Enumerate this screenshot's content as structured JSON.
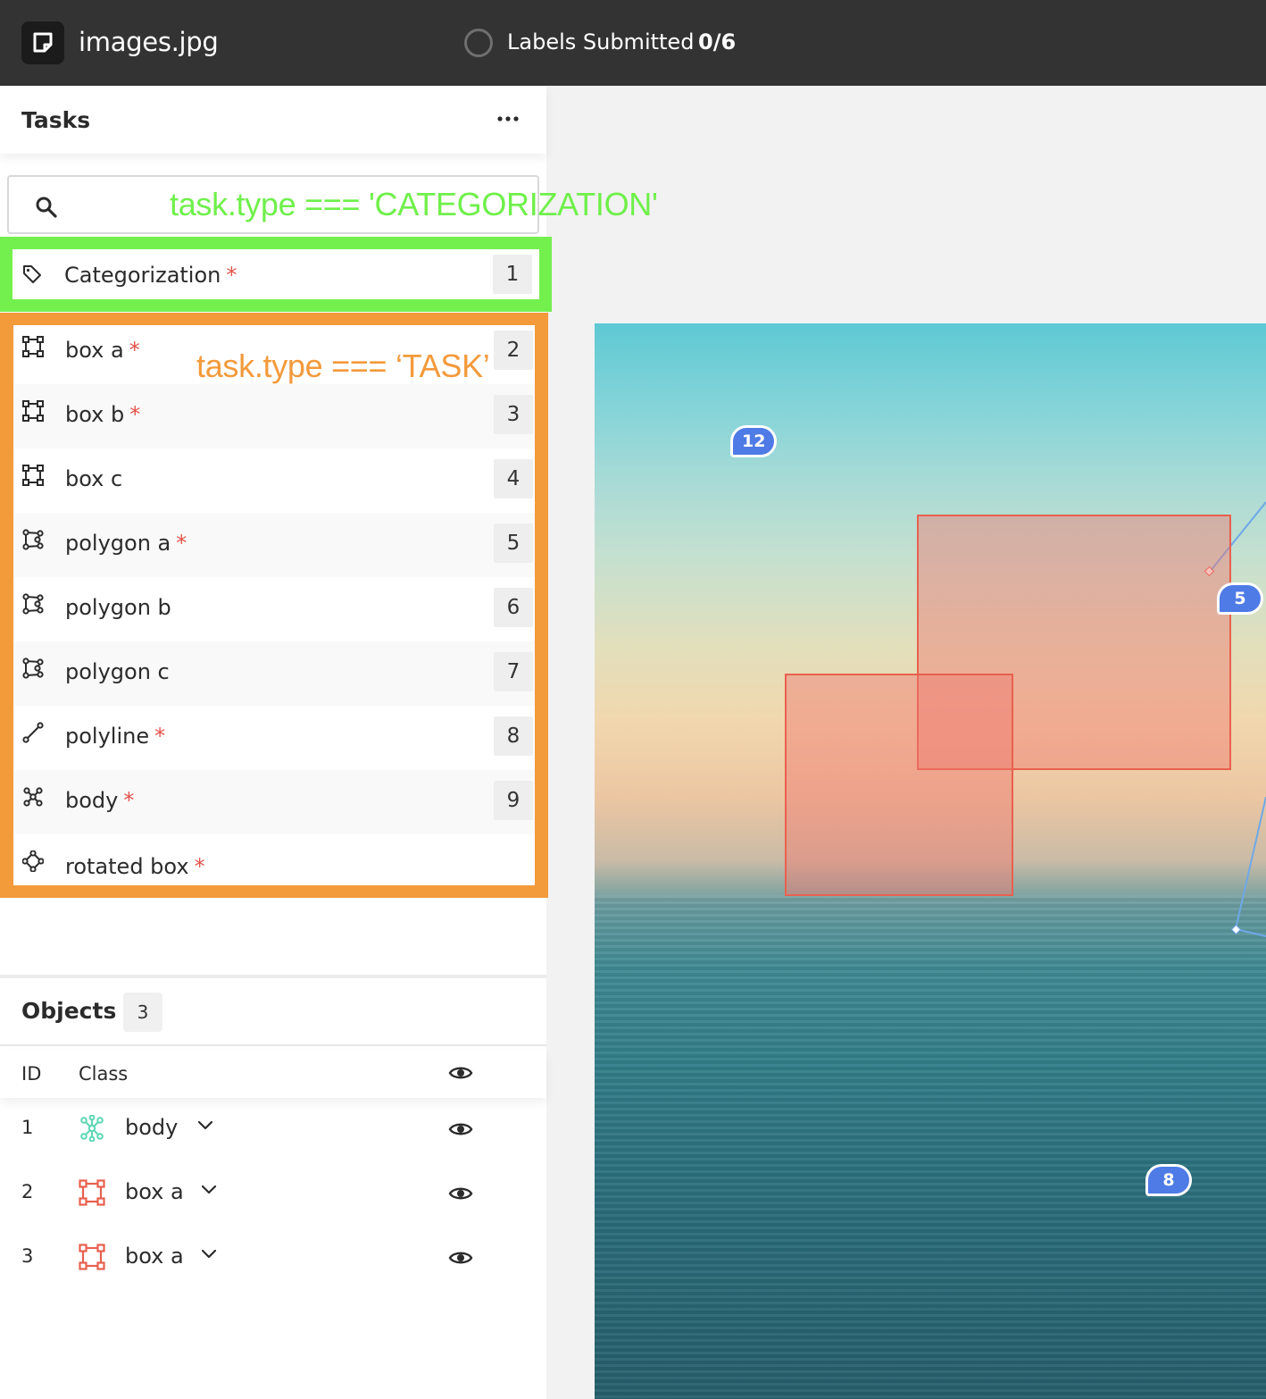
{
  "header": {
    "file_title": "images.jpg",
    "status_label": "Labels Submitted",
    "status_count": "0/6"
  },
  "tasks_panel": {
    "title": "Tasks",
    "more_label": "•••",
    "search": {
      "value": "",
      "placeholder": ""
    },
    "annotations": {
      "categorization_condition": "task.type === 'CATEGORIZATION'",
      "task_condition": "task.type === ‘TASK’",
      "categorization_color": "#74f04e",
      "task_color": "#f39a3b"
    },
    "categorization_item": {
      "label": "Categorization",
      "required_mark": "*",
      "number": "1",
      "icon": "tag-icon"
    },
    "items": [
      {
        "label": "box a",
        "required_mark": "*",
        "number": "2",
        "icon": "box-icon"
      },
      {
        "label": "box b",
        "required_mark": "*",
        "number": "3",
        "icon": "box-icon"
      },
      {
        "label": "box c",
        "required_mark": "",
        "number": "4",
        "icon": "box-icon"
      },
      {
        "label": "polygon a",
        "required_mark": "*",
        "number": "5",
        "icon": "polygon-icon"
      },
      {
        "label": "polygon b",
        "required_mark": "",
        "number": "6",
        "icon": "polygon-icon"
      },
      {
        "label": "polygon c",
        "required_mark": "",
        "number": "7",
        "icon": "polygon-icon"
      },
      {
        "label": "polyline",
        "required_mark": "*",
        "number": "8",
        "icon": "polyline-icon"
      },
      {
        "label": "body",
        "required_mark": "*",
        "number": "9",
        "icon": "keypoint-icon"
      },
      {
        "label": "rotated box",
        "required_mark": "*",
        "number": "",
        "icon": "rotated-box-icon"
      }
    ]
  },
  "objects_panel": {
    "title": "Objects",
    "count": "3",
    "columns": {
      "id": "ID",
      "class": "Class"
    },
    "rows": [
      {
        "id": "1",
        "class": "body",
        "icon": "keypoint-icon",
        "icon_color": "#5dd6b4"
      },
      {
        "id": "2",
        "class": "box a",
        "icon": "box-icon",
        "icon_color": "#e8604f"
      },
      {
        "id": "3",
        "class": "box a",
        "icon": "box-icon",
        "icon_color": "#e8604f"
      }
    ]
  },
  "canvas": {
    "pins": [
      {
        "label": "12"
      },
      {
        "label": "5"
      },
      {
        "label": "8"
      }
    ],
    "box_color": "#e8604f",
    "pin_color": "#4f7be6",
    "line_color": "#6fa8e8"
  }
}
